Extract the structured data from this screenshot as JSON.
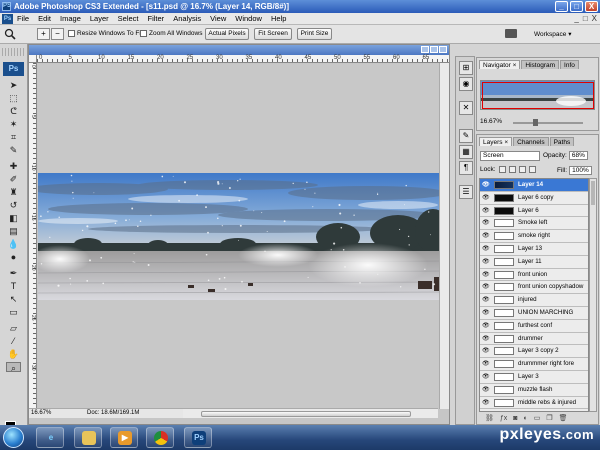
{
  "window": {
    "app_icon": "PS",
    "title": "Adobe Photoshop CS3 Extended - [s11.psd @ 16.7% (Layer 14, RGB/8#)]",
    "controls": [
      "_",
      "□",
      "X"
    ]
  },
  "menubar": {
    "logo": "Ps",
    "items": [
      "File",
      "Edit",
      "Image",
      "Layer",
      "Select",
      "Filter",
      "Analysis",
      "View",
      "Window",
      "Help"
    ],
    "doc_controls": [
      "_",
      "□",
      "X"
    ]
  },
  "options": {
    "resize_windows": "Resize Windows To Fit",
    "zoom_all": "Zoom All Windows",
    "actual_pixels": "Actual Pixels",
    "fit_screen": "Fit Screen",
    "print_size": "Print Size",
    "workspace": "Workspace ▾"
  },
  "document": {
    "ruler_ticks": [
      "0",
      "5",
      "10",
      "15",
      "20",
      "25",
      "30",
      "35",
      "40",
      "45",
      "50",
      "55",
      "60",
      "65"
    ],
    "ruler_vticks": [
      "0",
      "5",
      "10",
      "15",
      "20",
      "25",
      "30"
    ],
    "zoom": "16.67%",
    "doc_size": "Doc: 18.6M/169.1M"
  },
  "navigator": {
    "tabs": [
      "Navigator ×",
      "Histogram",
      "Info"
    ],
    "zoom": "16.67%",
    "zoom_level": 0.3
  },
  "layers_panel": {
    "tabs": [
      "Layers ×",
      "Channels",
      "Paths"
    ],
    "blend_mode": "Screen",
    "opacity_label": "Opacity:",
    "opacity": "68%",
    "lock_label": "Lock:",
    "fill_label": "Fill:",
    "fill": "100%",
    "layers": [
      {
        "name": "Layer 14",
        "thumb": "darkblue",
        "selected": true
      },
      {
        "name": "Layer 6 copy",
        "thumb": "dark",
        "selected": false
      },
      {
        "name": "Layer 6",
        "thumb": "dark",
        "selected": false
      },
      {
        "name": "Smoke left",
        "thumb": "light",
        "selected": false
      },
      {
        "name": "smoke right",
        "thumb": "light",
        "selected": false
      },
      {
        "name": "Layer 13",
        "thumb": "light",
        "selected": false
      },
      {
        "name": "Layer 11",
        "thumb": "light",
        "selected": false
      },
      {
        "name": "front union",
        "thumb": "light",
        "selected": false
      },
      {
        "name": "front union copyshadow",
        "thumb": "light",
        "selected": false
      },
      {
        "name": "injured",
        "thumb": "light",
        "selected": false
      },
      {
        "name": "UNION MARCHING",
        "thumb": "light",
        "selected": false
      },
      {
        "name": "furthest conf",
        "thumb": "light",
        "selected": false
      },
      {
        "name": "drummer",
        "thumb": "light",
        "selected": false
      },
      {
        "name": "Layer 3 copy 2",
        "thumb": "light",
        "selected": false
      },
      {
        "name": "drummmer right fore",
        "thumb": "light",
        "selected": false
      },
      {
        "name": "Layer 3",
        "thumb": "light",
        "selected": false
      },
      {
        "name": "muzzle flash",
        "thumb": "light",
        "selected": false
      },
      {
        "name": "middle rebs & injured",
        "thumb": "light",
        "selected": false
      }
    ],
    "footer_icons": [
      "link-icon",
      "fx-icon",
      "mask-icon",
      "adjustment-icon",
      "folder-icon",
      "new-layer-icon",
      "trash-icon"
    ]
  },
  "taskbar": {
    "apps": [
      "ie-icon",
      "explorer-icon",
      "media-player-icon",
      "chrome-icon",
      "photoshop-icon"
    ],
    "ps_label": "Ps",
    "watermark_main": "pxleyes",
    "watermark_dom": ".com"
  },
  "colors": {
    "title_blue": "#2b5bb8",
    "selection_blue": "#3a78d4",
    "nav_frame_red": "#e00000"
  }
}
